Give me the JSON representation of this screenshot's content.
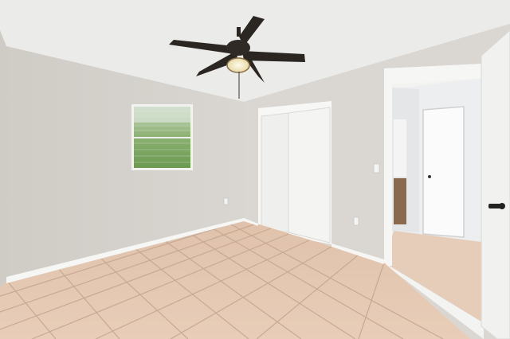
{
  "scene": {
    "kind": "empty-bedroom-photo",
    "colors": {
      "ceiling": "#ebebe9",
      "left_wall": "#d5d2cd",
      "back_wall": "#dcdad6",
      "right_wall": "#d6d3cd",
      "floor_tile": "#e3c6b0",
      "grout": "#c4a48e",
      "baseboard": "#f4f4f2",
      "closet_door": "#f2f2f1",
      "fan_blade": "#2b2622",
      "window_green": "#7fa464"
    },
    "objects": [
      {
        "name": "ceiling-fan",
        "icon": "ceiling-fan-icon"
      },
      {
        "name": "window",
        "icon": "window-icon"
      },
      {
        "name": "closet-bifold-doors",
        "icon": "closet-door-icon"
      },
      {
        "name": "open-doorway",
        "icon": "doorway-icon"
      },
      {
        "name": "bathroom-door",
        "icon": "door-icon"
      },
      {
        "name": "bedroom-door-open",
        "icon": "door-icon"
      },
      {
        "name": "tile-floor",
        "icon": "tile-floor-icon"
      }
    ]
  }
}
